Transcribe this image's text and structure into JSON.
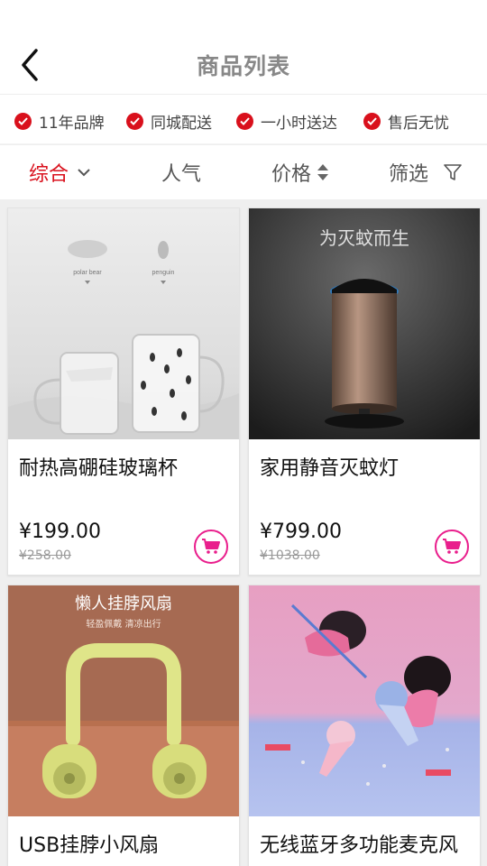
{
  "header": {
    "title": "商品列表"
  },
  "features": [
    {
      "label": "11年品牌"
    },
    {
      "label": "同城配送"
    },
    {
      "label": "一小时送达"
    },
    {
      "label": "售后无忧"
    }
  ],
  "sortbar": {
    "comprehensive": "综合",
    "popularity": "人气",
    "price": "价格",
    "filter": "筛选"
  },
  "products": [
    {
      "name": "耐热高硼硅玻璃杯",
      "price": "¥199.00",
      "old_price": "¥258.00",
      "image": {
        "label1": "polar bear",
        "label2": "penguin"
      }
    },
    {
      "name": "家用静音灭蚊灯",
      "price": "¥799.00",
      "old_price": "¥1038.00",
      "image": {
        "caption": "为灭蚊而生"
      }
    },
    {
      "name": "USB挂脖小风扇",
      "image": {
        "caption": "懒人挂脖风扇",
        "subcaption": "轻盈佩戴  清凉出行"
      }
    },
    {
      "name": "无线蓝牙多功能麦克风"
    }
  ],
  "colors": {
    "accent": "#d9101c",
    "cart": "#e91e8c"
  }
}
